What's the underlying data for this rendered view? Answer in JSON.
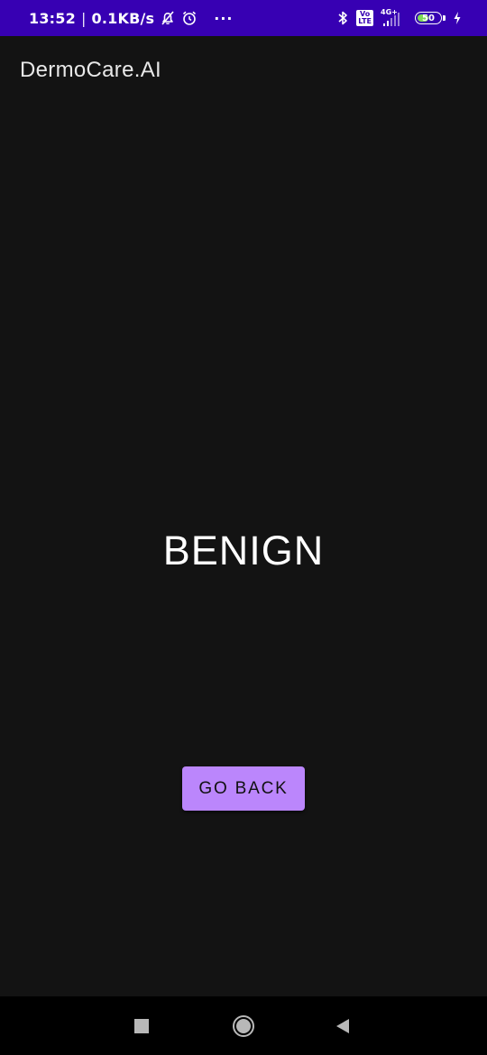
{
  "status_bar": {
    "time": "13:52",
    "separator": "|",
    "speed": "0.1KB/s",
    "more": "···",
    "volte": "Vo\nLTE",
    "network": "4G+",
    "battery_level": "50",
    "battery_fraction": 0.5,
    "background_color": "#3700b3",
    "icons": [
      "mute-bell-icon",
      "alarm-icon",
      "bluetooth-icon",
      "volte-icon",
      "signal-icon",
      "battery-icon",
      "charging-icon"
    ]
  },
  "app_bar": {
    "title": "DermoCare.AI"
  },
  "result": {
    "label": "BENIGN"
  },
  "actions": {
    "go_back_label": "GO BACK",
    "button_color": "#bb86fc"
  },
  "nav_bar": {
    "icons": [
      "recents-icon",
      "home-icon",
      "back-icon"
    ]
  }
}
